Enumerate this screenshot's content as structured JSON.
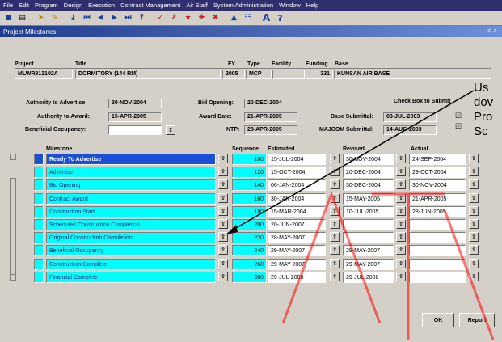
{
  "menu": [
    "File",
    "Edit",
    "Program",
    "Design",
    "Execution",
    "Contract Management",
    "Air Staff",
    "System Administration",
    "Window",
    "Help"
  ],
  "toolbar_icons": [
    "save-icon",
    "print-icon",
    "tool-icon",
    "tool-icon",
    "first-record-icon",
    "previous-record-icon",
    "previous-icon",
    "next-icon",
    "next-record-icon",
    "last-record-icon",
    "edit-icon",
    "edit-icon",
    "query-icon",
    "insert-icon",
    "delete-icon",
    "chart-icon",
    "list-icon",
    "font-icon",
    "help-icon"
  ],
  "window": {
    "title": "Project Milestones"
  },
  "header": {
    "project_label": "Project",
    "project_value": "MLWR813102A",
    "title_label": "Title",
    "title_value": "DORMITORY (144 RM)",
    "fy_label": "FY",
    "fy_value": "2005",
    "type_label": "Type",
    "type_value": "MCP",
    "facility_label": "Facility",
    "facility_value": "",
    "funding_label": "Funding",
    "funding_value": "331",
    "base_label": "Base",
    "base_value": "KUNSAN AIR BASE"
  },
  "dates": {
    "auth_advertise_label": "Authority to Advertise:",
    "auth_advertise_value": "30-NOV-2004",
    "auth_award_label": "Authority to Award:",
    "auth_award_value": "15-APR-2005",
    "beneficial_label": "Beneficial Occupancy:",
    "beneficial_value": "",
    "bid_opening_label": "Bid Opening:",
    "bid_opening_value": "20-DEC-2004",
    "award_date_label": "Award Date:",
    "award_date_value": "21-APR-2005",
    "ntp_label": "NTP:",
    "ntp_value": "28-APR-2005",
    "check_box_label": "Check Box to Submit",
    "base_submittal_label": "Base Submittal:",
    "base_submittal_value": "03-JUL-2003",
    "majcom_submittal_label": "MAJCOM Submittal:",
    "majcom_submittal_value": "14-AUG-2003"
  },
  "grid": {
    "columns": [
      "Milestone",
      "Sequence",
      "Estimated",
      "Revised",
      "Actual"
    ],
    "rows": [
      {
        "milestone": "Ready To Advertise",
        "sequence": "100",
        "estimated": "15-JUL-2004",
        "revised": "30-NOV-2004",
        "actual": "24-SEP-2004"
      },
      {
        "milestone": "Advertise",
        "sequence": "120",
        "estimated": "15-OCT-2004",
        "revised": "20-DEC-2004",
        "actual": "29-OCT-2004"
      },
      {
        "milestone": "Bid Opening",
        "sequence": "140",
        "estimated": "06-JAN-2004",
        "revised": "30-DEC-2004",
        "actual": "30-NOV-2004"
      },
      {
        "milestone": "Contract Award",
        "sequence": "160",
        "estimated": "30-JAN-2004",
        "revised": "15-MAY-2005",
        "actual": "21-APR-2005"
      },
      {
        "milestone": "Construction Start",
        "sequence": "180",
        "estimated": "15-MAR-2004",
        "revised": "10-JUL-2005",
        "actual": "28-JUN-2005"
      },
      {
        "milestone": "Scheduled Construction Completion",
        "sequence": "200",
        "estimated": "20-JUN-2007",
        "revised": "",
        "actual": ""
      },
      {
        "milestone": "Original Construction Completion",
        "sequence": "220",
        "estimated": "28-MAY-2007",
        "revised": "",
        "actual": ""
      },
      {
        "milestone": "Beneficial Occupancy",
        "sequence": "240",
        "estimated": "29-MAY-2007",
        "revised": "29-MAY-2007",
        "actual": ""
      },
      {
        "milestone": "Construction Complete",
        "sequence": "260",
        "estimated": "29-MAY-2007",
        "revised": "29-MAY-2007",
        "actual": ""
      },
      {
        "milestone": "Financial Complete",
        "sequence": "280",
        "estimated": "29-JUL-2008",
        "revised": "29-JUL-2008",
        "actual": ""
      }
    ]
  },
  "buttons": {
    "ok": "OK",
    "report": "Report"
  },
  "callout": {
    "line1": "Us",
    "line2": "dov",
    "line3": "Pro",
    "line4": "Sc"
  },
  "colors": {
    "menubar": "#2f2f6f",
    "titlebar": "#1e3c8c",
    "grid_cell": "#00ffff",
    "selected": "#1a4fd6"
  }
}
